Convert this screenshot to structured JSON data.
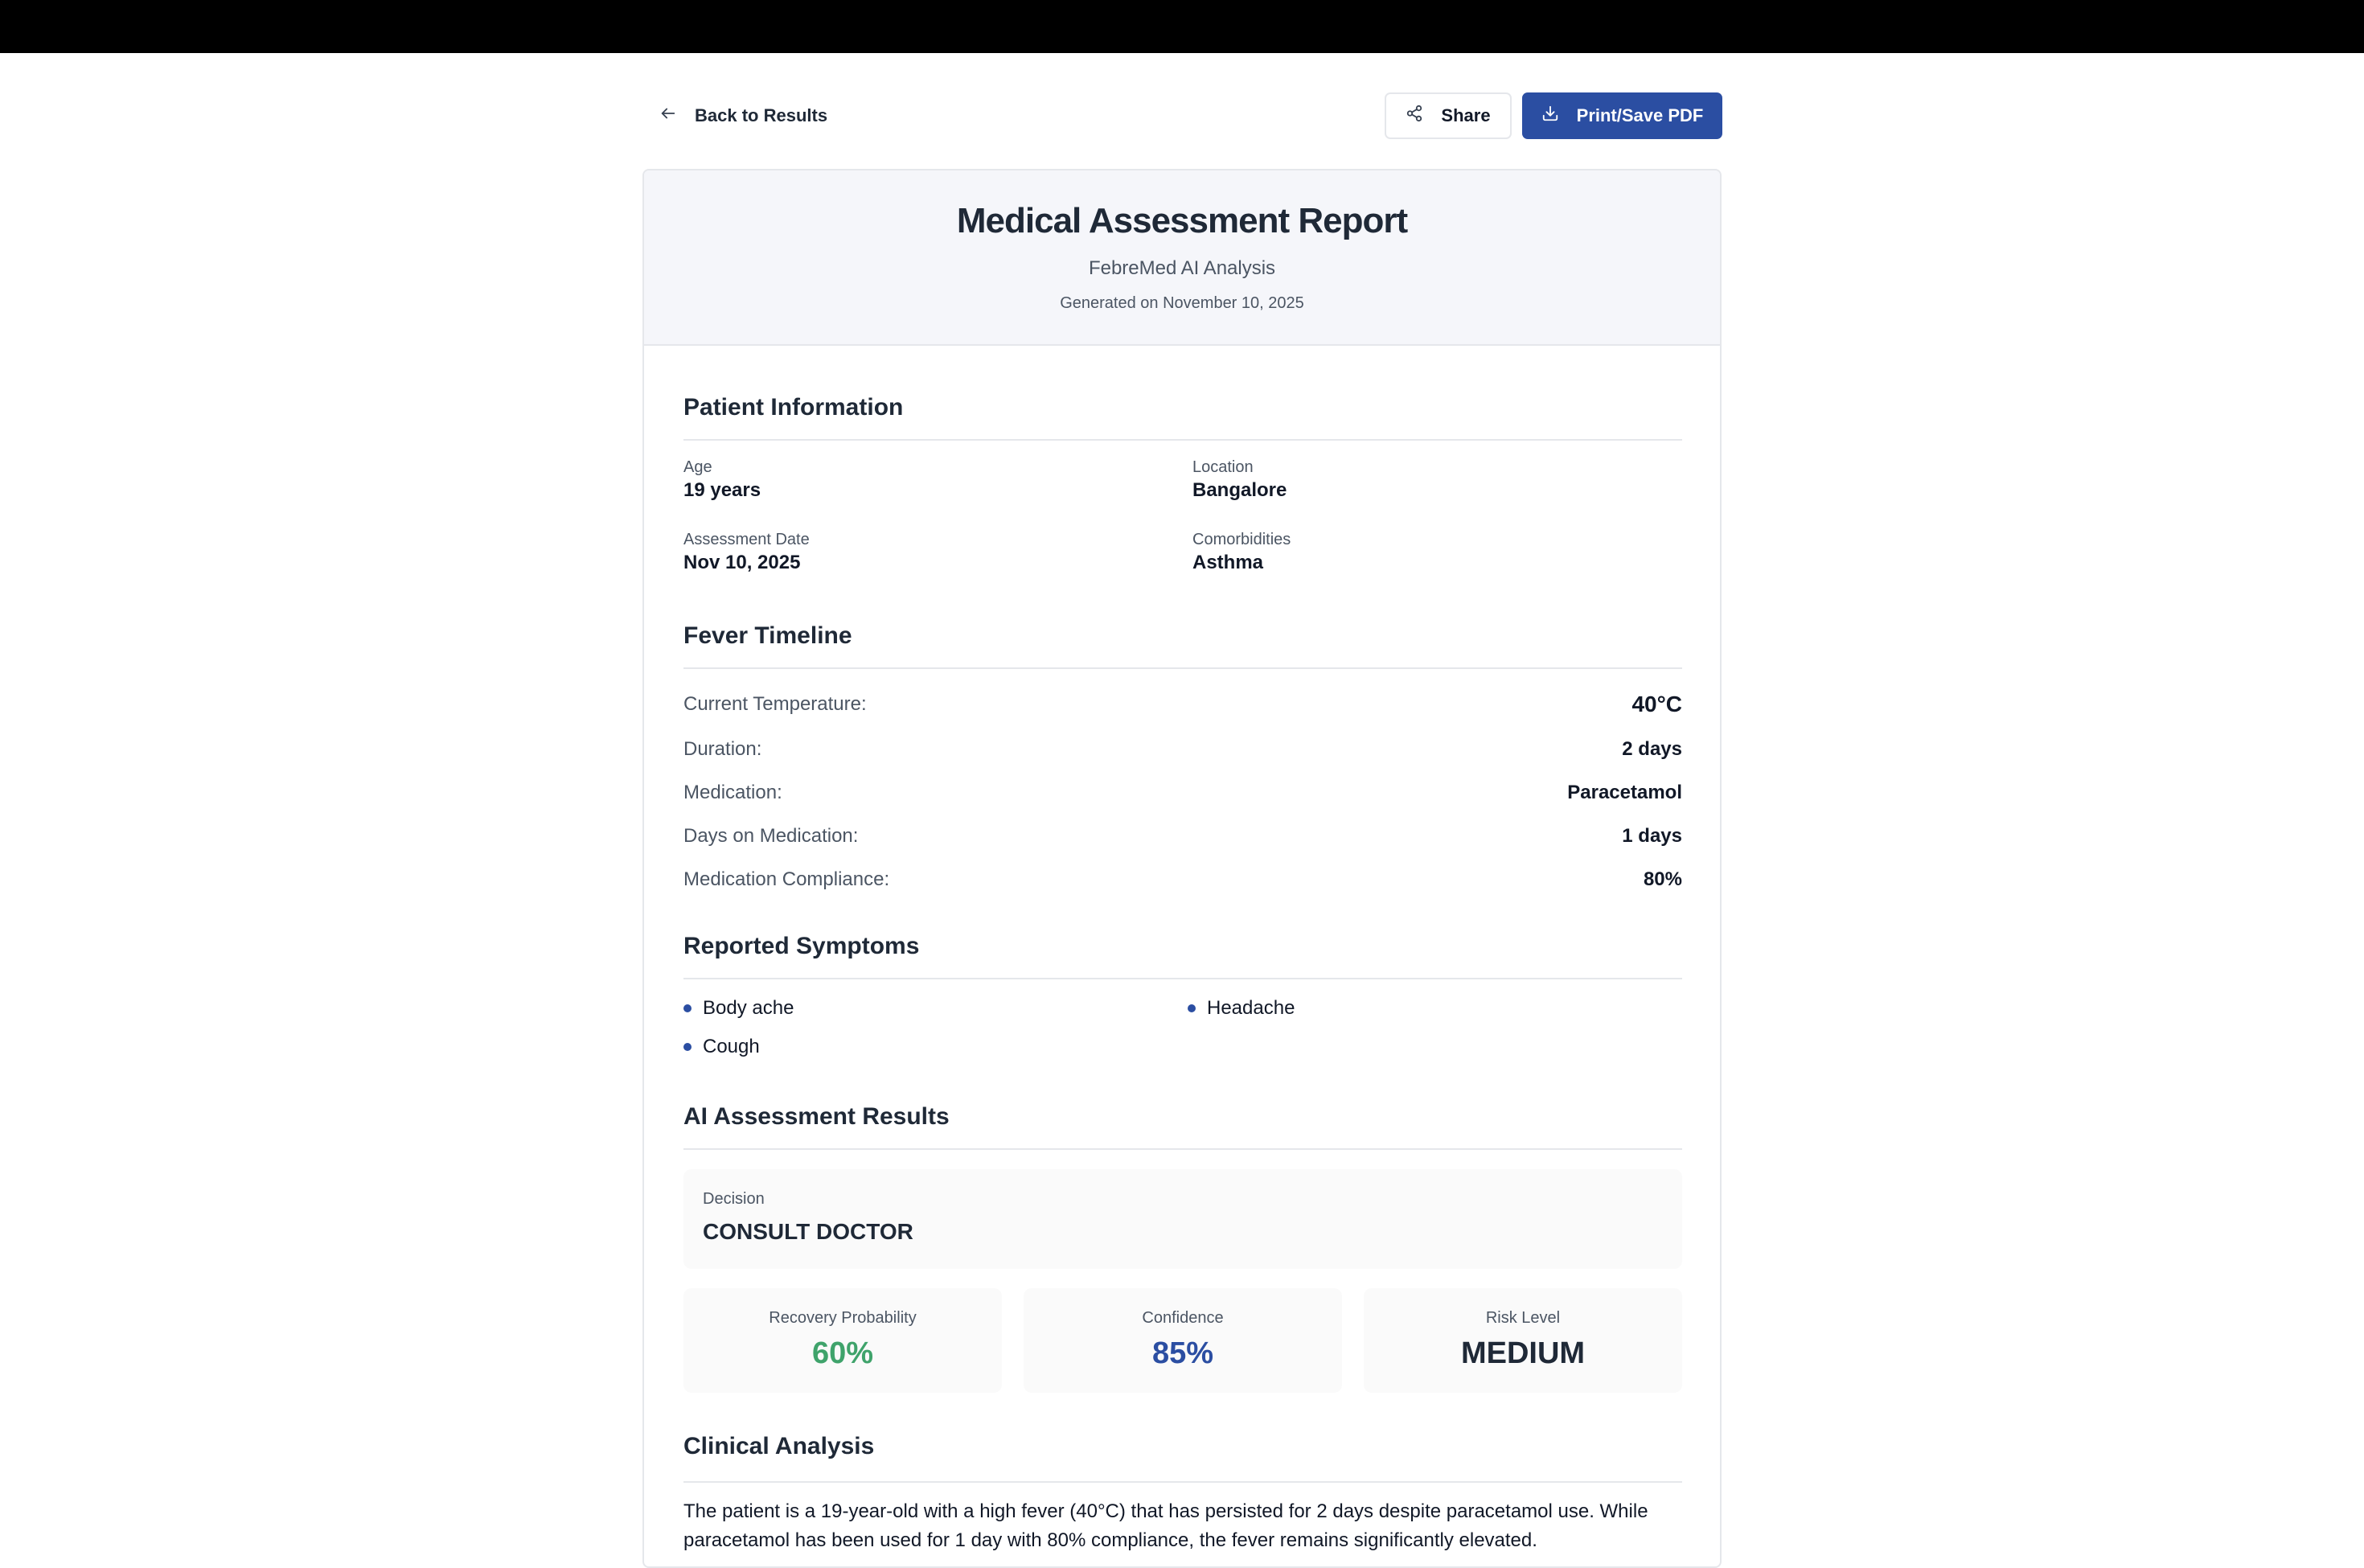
{
  "toolbar": {
    "back_label": "Back to Results",
    "share_label": "Share",
    "print_label": "Print/Save PDF"
  },
  "header": {
    "title": "Medical Assessment Report",
    "subtitle": "FebreMed AI Analysis",
    "generated": "Generated on November 10, 2025"
  },
  "patient": {
    "title": "Patient Information",
    "age_label": "Age",
    "age_value": "19 years",
    "location_label": "Location",
    "location_value": "Bangalore",
    "date_label": "Assessment Date",
    "date_value": "Nov 10, 2025",
    "comorbidities_label": "Comorbidities",
    "comorbidities_value": "Asthma"
  },
  "timeline": {
    "title": "Fever Timeline",
    "rows": [
      {
        "label": "Current Temperature:",
        "value": "40°C"
      },
      {
        "label": "Duration:",
        "value": "2 days"
      },
      {
        "label": "Medication:",
        "value": "Paracetamol"
      },
      {
        "label": "Days on Medication:",
        "value": "1 days"
      },
      {
        "label": "Medication Compliance:",
        "value": "80%"
      }
    ]
  },
  "symptoms": {
    "title": "Reported Symptoms",
    "items": [
      "Body ache",
      "Headache",
      "Cough"
    ]
  },
  "assessment": {
    "title": "AI Assessment Results",
    "decision_label": "Decision",
    "decision_value": "CONSULT DOCTOR",
    "metrics": [
      {
        "label": "Recovery Probability",
        "value": "60%",
        "color": "#3fa36b"
      },
      {
        "label": "Confidence",
        "value": "85%",
        "color": "#2b4ea2"
      },
      {
        "label": "Risk Level",
        "value": "MEDIUM",
        "color": "#1f2937"
      }
    ]
  },
  "analysis": {
    "title": "Clinical Analysis",
    "text": "The patient is a 19-year-old with a high fever (40°C) that has persisted for 2 days despite paracetamol use. While paracetamol has been used for 1 day with 80% compliance, the fever remains significantly elevated."
  },
  "colors": {
    "accent": "#2b4ea2",
    "recovery": "#3fa36b"
  }
}
